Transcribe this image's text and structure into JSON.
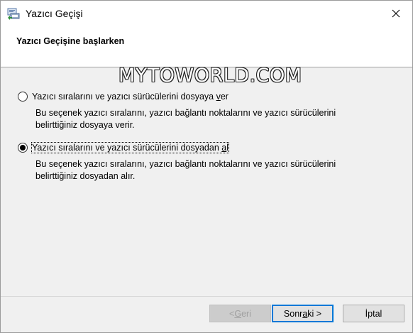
{
  "window": {
    "title": "Yazıcı Geçişi",
    "close_symbol": "✕"
  },
  "header": {
    "title": "Yazıcı Geçişine başlarken"
  },
  "watermark": "MYTOWORLD.COM",
  "options": [
    {
      "label_pre": "Yazıcı sıralarını ve yazıcı sürücülerini dosyaya ",
      "label_access": "v",
      "label_post": "er",
      "description_line1": "Bu seçenek yazıcı sıralarını, yazıcı bağlantı noktalarını ve yazıcı sürücülerini",
      "description_line2": "belirttiğiniz dosyaya verir.",
      "checked": false
    },
    {
      "label_pre": "Yazıcı sıralarını ve yazıcı sürücülerini dosyadan ",
      "label_access": "a",
      "label_post": "l",
      "description_line1": "Bu seçenek yazıcı sıralarını, yazıcı bağlantı noktalarını ve yazıcı sürücülerini",
      "description_line2": "belirttiğiniz dosyadan alır.",
      "checked": true
    }
  ],
  "buttons": {
    "back_pre": "< ",
    "back_access": "G",
    "back_post": "eri",
    "next_pre": "Sonr",
    "next_access": "a",
    "next_post": "ki >",
    "cancel": "İptal"
  }
}
